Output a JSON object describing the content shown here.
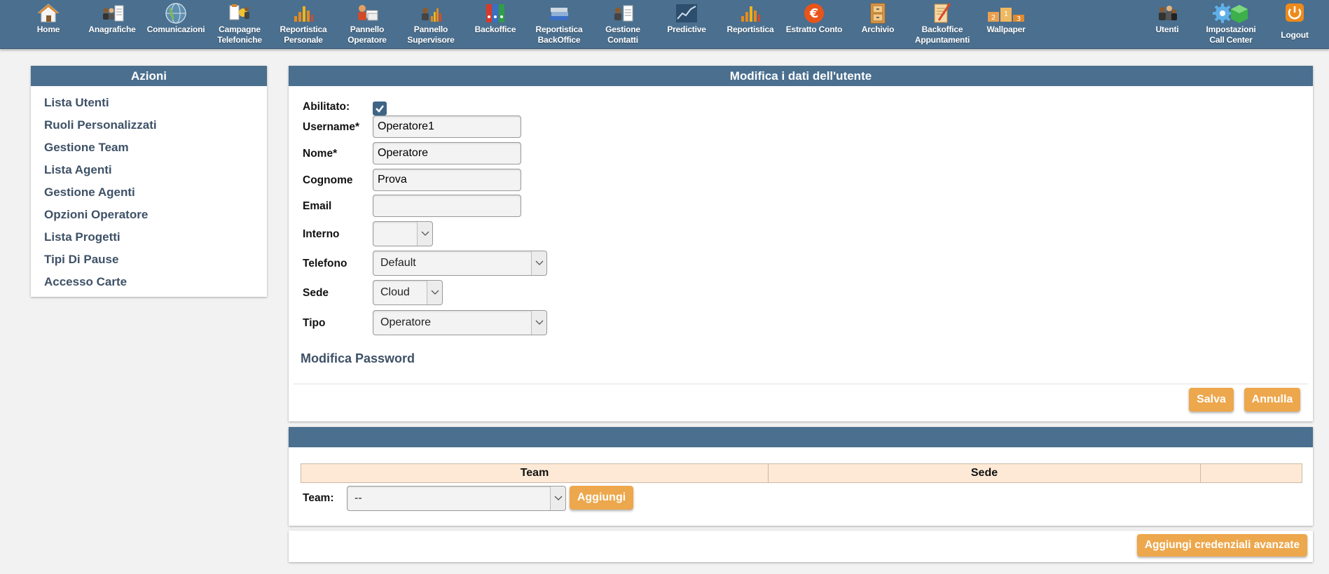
{
  "toolbar": {
    "items": [
      {
        "name": "home",
        "label": "Home",
        "icon": "house-icon"
      },
      {
        "name": "anagrafiche",
        "label": "Anagrafiche",
        "icon": "people-document-icon"
      },
      {
        "name": "comunicazioni",
        "label": "Comunicazioni",
        "icon": "globe-icon"
      },
      {
        "name": "campagne-telefoniche",
        "label": "Campagne\nTelefoniche",
        "icon": "clipboard-people-icon"
      },
      {
        "name": "reportistica-personale",
        "label": "Reportistica\nPersonale",
        "icon": "bar-chart-icon"
      },
      {
        "name": "pannello-operatore",
        "label": "Pannello\nOperatore",
        "icon": "operator-windows-icon"
      },
      {
        "name": "pannello-supervisore",
        "label": "Pannello\nSupervisore",
        "icon": "supervisor-chart-icon"
      },
      {
        "name": "backoffice",
        "label": "Backoffice",
        "icon": "binders-icon"
      },
      {
        "name": "reportistica-backoffice",
        "label": "Reportistica\nBackOffice",
        "icon": "books-icon"
      },
      {
        "name": "gestione-contatti",
        "label": "Gestione\nContatti",
        "icon": "person-document-icon"
      },
      {
        "name": "predictive",
        "label": "Predictive",
        "icon": "line-chart-icon"
      },
      {
        "name": "reportistica",
        "label": "Reportistica",
        "icon": "bar-chart-icon"
      },
      {
        "name": "estratto-conto",
        "label": "Estratto Conto",
        "icon": "euro-icon"
      },
      {
        "name": "archivio",
        "label": "Archivio",
        "icon": "cabinet-icon"
      },
      {
        "name": "backoffice-appuntamenti",
        "label": "Backoffice\nAppuntamenti",
        "icon": "notepad-pencil-icon"
      },
      {
        "name": "wallpaper",
        "label": "Wallpaper",
        "icon": "podium-icon"
      }
    ],
    "right_items": [
      {
        "name": "utenti",
        "label": "Utenti",
        "icon": "users-icon"
      },
      {
        "name": "impostazioni-call-center",
        "label": "Impostazioni\nCall Center",
        "icon": "gears-icon"
      },
      {
        "name": "logout",
        "label": "Logout",
        "icon": "power-icon"
      }
    ]
  },
  "sidebar": {
    "title": "Azioni",
    "items": [
      "Lista Utenti",
      "Ruoli Personalizzati",
      "Gestione Team",
      "Lista Agenti",
      "Gestione Agenti",
      "Opzioni Operatore",
      "Lista Progetti",
      "Tipi Di Pause",
      "Accesso Carte"
    ]
  },
  "form": {
    "title": "Modifica i dati dell'utente",
    "abilitato_label": "Abilitato:",
    "abilitato_checked": true,
    "username_label": "Username*",
    "username_value": "Operatore1",
    "nome_label": "Nome*",
    "nome_value": "Operatore",
    "cognome_label": "Cognome",
    "cognome_value": "Prova",
    "email_label": "Email",
    "email_value": "",
    "interno_label": "Interno",
    "interno_value": "",
    "telefono_label": "Telefono",
    "telefono_value": "Default",
    "sede_label": "Sede",
    "sede_value": "Cloud",
    "tipo_label": "Tipo",
    "tipo_value": "Operatore",
    "password_section": "Modifica Password",
    "save_label": "Salva",
    "cancel_label": "Annulla"
  },
  "team_panel": {
    "title": "",
    "columns": [
      "Team",
      "Sede",
      ""
    ],
    "team_label": "Team:",
    "team_select_value": "--",
    "add_label": "Aggiungi"
  },
  "advanced": {
    "button_label": "Aggiungi credenziali avanzate"
  },
  "colors": {
    "header_blue": "#4a6f8f",
    "accent_orange": "#eda74c",
    "table_head_bg": "#fde9d6",
    "sidebar_text": "#3e5167"
  }
}
